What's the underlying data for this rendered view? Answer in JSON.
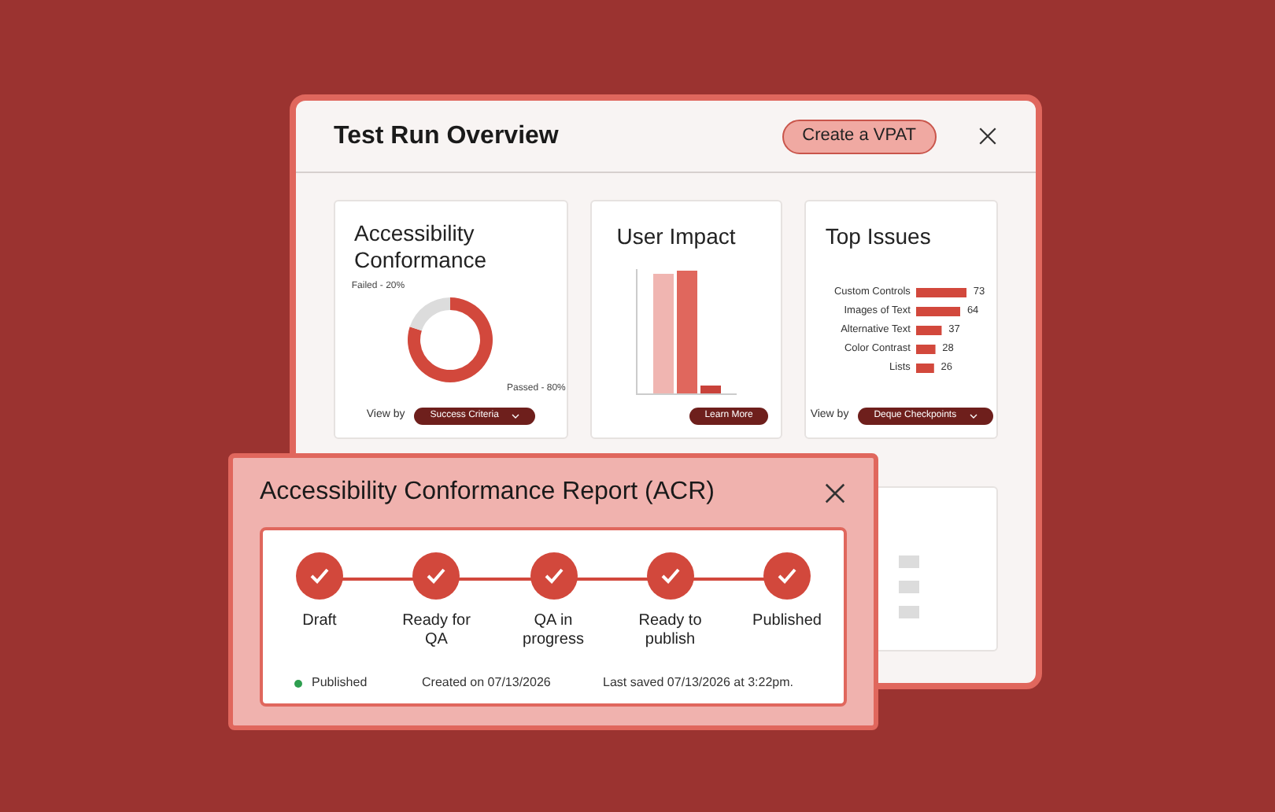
{
  "overview": {
    "title": "Test Run Overview",
    "action": "Create a VPAT",
    "conformance": {
      "title": "Accessibility Conformance",
      "view_label": "View by",
      "view_value": "Success Criteria",
      "chart_data": {
        "type": "donut",
        "categories": [
          "Passed - 80%",
          "Failed - 20%"
        ],
        "values": [
          80,
          20
        ]
      }
    },
    "impact": {
      "title": "User Impact",
      "button": "Learn More"
    },
    "issues": {
      "title": "Top Issues",
      "view_label": "View by",
      "view_value": "Deque Checkpoints",
      "chart_data": {
        "type": "bar",
        "orientation": "horizontal",
        "categories": [
          "Custom Controls",
          "Images of Text",
          "Alternative Text",
          "Color Contrast",
          "Lists"
        ],
        "values": [
          73,
          64,
          37,
          28,
          26
        ],
        "data_labels": true
      }
    }
  },
  "acr": {
    "title": "Accessibility Conformance Report (ACR)",
    "steps": [
      {
        "label": "Draft",
        "done": true
      },
      {
        "label": "Ready for QA",
        "done": true
      },
      {
        "label": "QA in progress",
        "done": true
      },
      {
        "label": "Ready to publish",
        "done": true
      },
      {
        "label": "Published",
        "done": true
      }
    ],
    "status": {
      "label": "Published",
      "color": "#2e9e4f"
    },
    "created": "Created on 07/13/2026",
    "saved": "Last saved 07/13/2026 at 3:22pm."
  }
}
